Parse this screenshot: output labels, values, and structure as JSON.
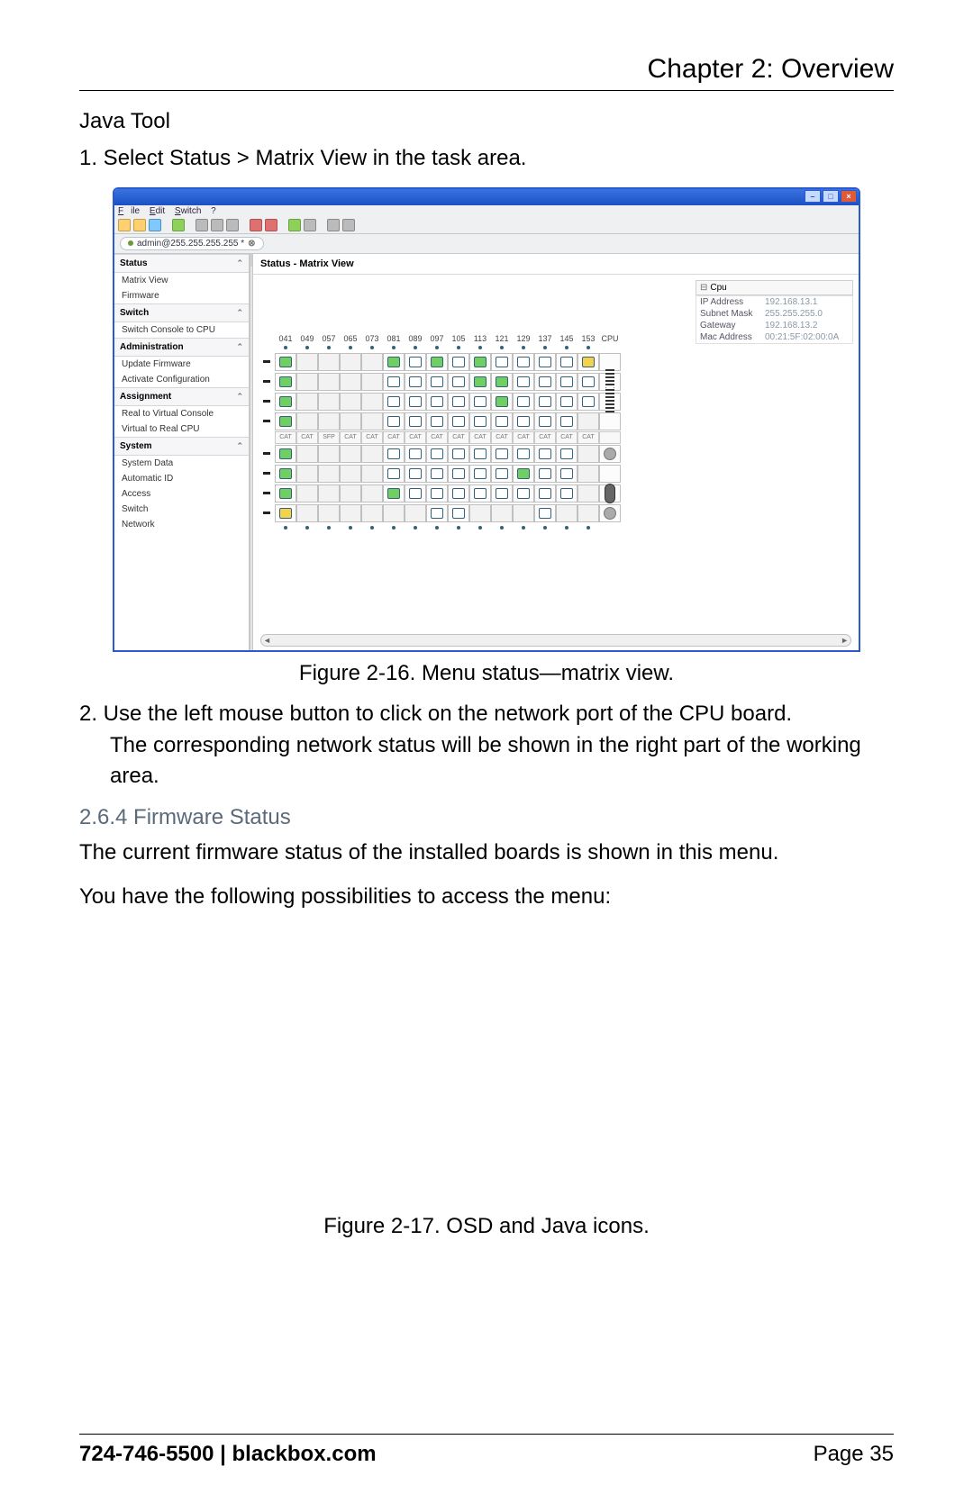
{
  "page": {
    "chapter_title": "Chapter 2: Overview",
    "subheading": "Java Tool",
    "step1": "1. Select Status > Matrix View in the task area.",
    "fig216_caption": "Figure 2-16. Menu status—matrix view.",
    "step2a": "2. Use the left mouse button to click on the network port of the CPU board.",
    "step2b": "The corresponding network status will be shown in the right part of the working area.",
    "section_264": "2.6.4 Firmware Status",
    "para_264a": "The current firmware status of the installed boards is shown in this menu.",
    "para_264b": "You have the following possibilities to access the menu:",
    "fig217_caption": "Figure 2-17. OSD and Java icons.",
    "footer_left": "724-746-5500    |    blackbox.com",
    "footer_right": "Page 35"
  },
  "screenshot": {
    "menubar": {
      "file": "File",
      "edit": "Edit",
      "switch": "Switch",
      "help": "?"
    },
    "tab_label": "admin@255.255.255.255 *",
    "main_title": "Status - Matrix View",
    "sidebar": {
      "groups": [
        {
          "title": "Status",
          "items": [
            "Matrix View",
            "Firmware"
          ]
        },
        {
          "title": "Switch",
          "items": [
            "Switch Console to CPU"
          ]
        },
        {
          "title": "Administration",
          "items": [
            "Update Firmware",
            "Activate Configuration"
          ]
        },
        {
          "title": "Assignment",
          "items": [
            "Real to Virtual Console",
            "Virtual to Real CPU"
          ]
        },
        {
          "title": "System",
          "items": [
            "System Data",
            "Automatic ID",
            "Access",
            "Switch",
            "Network"
          ]
        }
      ]
    },
    "columns": [
      "041",
      "049",
      "057",
      "065",
      "073",
      "081",
      "089",
      "097",
      "105",
      "113",
      "121",
      "129",
      "137",
      "145",
      "153",
      "CPU"
    ],
    "cat_labels": [
      "CAT",
      "CAT",
      "SFP",
      "CAT",
      "CAT",
      "CAT",
      "CAT",
      "CAT",
      "CAT",
      "CAT",
      "CAT",
      "CAT",
      "CAT",
      "CAT",
      "CAT",
      ""
    ],
    "grid_rows": [
      [
        "G",
        "",
        "",
        "",
        "",
        "G",
        "W",
        "G",
        "W",
        "G",
        "W",
        "W",
        "W",
        "W",
        "Y"
      ],
      [
        "G",
        "",
        "",
        "",
        "",
        "W",
        "W",
        "W",
        "W",
        "G",
        "G",
        "W",
        "W",
        "W",
        "W"
      ],
      [
        "G",
        "",
        "",
        "",
        "",
        "W",
        "W",
        "W",
        "W",
        "W",
        "G",
        "W",
        "W",
        "W",
        "W"
      ],
      [
        "G",
        "",
        "",
        "",
        "",
        "W",
        "W",
        "W",
        "W",
        "W",
        "W",
        "W",
        "W",
        "W",
        ""
      ]
    ],
    "grid_rows2": [
      [
        "G",
        "",
        "",
        "",
        "",
        "W",
        "W",
        "W",
        "W",
        "W",
        "W",
        "W",
        "W",
        "W",
        ""
      ],
      [
        "G",
        "",
        "",
        "",
        "",
        "W",
        "W",
        "W",
        "W",
        "W",
        "W",
        "G",
        "W",
        "W",
        ""
      ],
      [
        "G",
        "",
        "",
        "",
        "",
        "G",
        "W",
        "W",
        "W",
        "W",
        "W",
        "W",
        "W",
        "W",
        ""
      ],
      [
        "Y",
        "",
        "",
        "",
        "",
        "",
        "",
        "W",
        "W",
        "",
        "",
        "",
        "W",
        "",
        ""
      ]
    ],
    "info": {
      "head": "Cpu",
      "rows": [
        {
          "k": "IP Address",
          "v": "192.168.13.1"
        },
        {
          "k": "Subnet Mask",
          "v": "255.255.255.0"
        },
        {
          "k": "Gateway",
          "v": "192.168.13.2"
        },
        {
          "k": "Mac Address",
          "v": "00:21:5F:02:00:0A"
        }
      ]
    }
  }
}
